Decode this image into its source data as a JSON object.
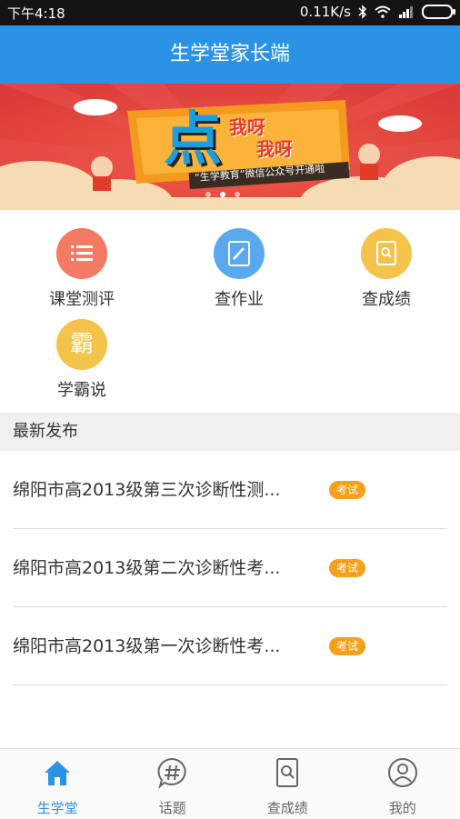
{
  "status_bar": {
    "time": "下午4:18",
    "network_speed": "0.11K/s"
  },
  "header": {
    "title": "生学堂家长端"
  },
  "banner": {
    "big_char": "点",
    "phrase_1": "我呀",
    "phrase_2": "我呀",
    "caption": "“生学教育”微信公众号开通啦",
    "pages": 3,
    "active_page": 2
  },
  "features": [
    {
      "label": "课堂测评",
      "color": "#f47a64",
      "icon": "list-icon"
    },
    {
      "label": "查作业",
      "color": "#5aa9ee",
      "icon": "edit-icon"
    },
    {
      "label": "查成绩",
      "color": "#f3c34a",
      "icon": "search-doc-icon"
    },
    {
      "label": "学霸说",
      "color": "#f3c34a",
      "icon_text": "霸"
    }
  ],
  "latest": {
    "heading": "最新发布",
    "items": [
      {
        "title": "绵阳市高2013级第三次诊断性测...",
        "tag": "考试"
      },
      {
        "title": "绵阳市高2013级第二次诊断性考...",
        "tag": "考试"
      },
      {
        "title": "绵阳市高2013级第一次诊断性考...",
        "tag": "考试"
      }
    ]
  },
  "tabs": [
    {
      "label": "生学堂",
      "icon": "home-icon",
      "active": true
    },
    {
      "label": "话题",
      "icon": "hashtag-icon",
      "active": false
    },
    {
      "label": "查成绩",
      "icon": "search-doc-icon",
      "active": false
    },
    {
      "label": "我的",
      "icon": "profile-icon",
      "active": false
    }
  ],
  "colors": {
    "primary": "#2b93e5",
    "tag": "#f5a11d"
  }
}
